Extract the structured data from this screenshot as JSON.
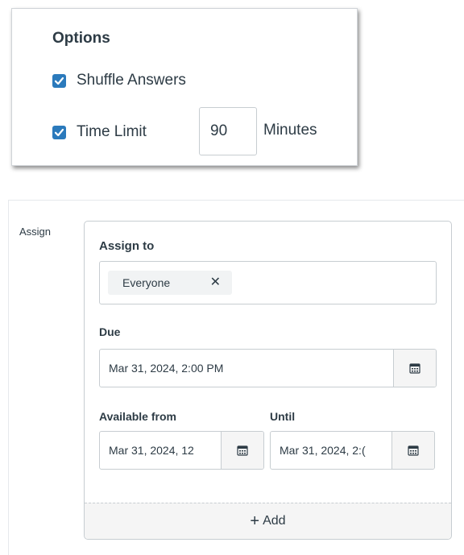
{
  "options": {
    "title": "Options",
    "shuffle_label": "Shuffle Answers",
    "shuffle_checked": true,
    "time_limit_label": "Time Limit",
    "time_limit_checked": true,
    "time_limit_value": "90",
    "minutes_label": "Minutes"
  },
  "assign": {
    "side_label": "Assign",
    "assign_to_label": "Assign to",
    "assignee_tag": "Everyone",
    "remove_symbol": "✕",
    "due_label": "Due",
    "due_value": "Mar 31, 2024, 2:00 PM",
    "available_from_label": "Available from",
    "available_from_value": "Mar 31, 2024, 12",
    "until_label": "Until",
    "until_value": "Mar 31, 2024, 2:(",
    "add_plus": "+",
    "add_label": "Add"
  },
  "icons": {
    "checkbox": "checkmark-icon",
    "calendar": "calendar-icon",
    "remove": "close-icon",
    "add": "plus-icon"
  },
  "colors": {
    "checkbox_fill": "#2b7abc",
    "text": "#2d3b45",
    "border": "#c7cdd1",
    "button_bg": "#f5f5f5"
  }
}
